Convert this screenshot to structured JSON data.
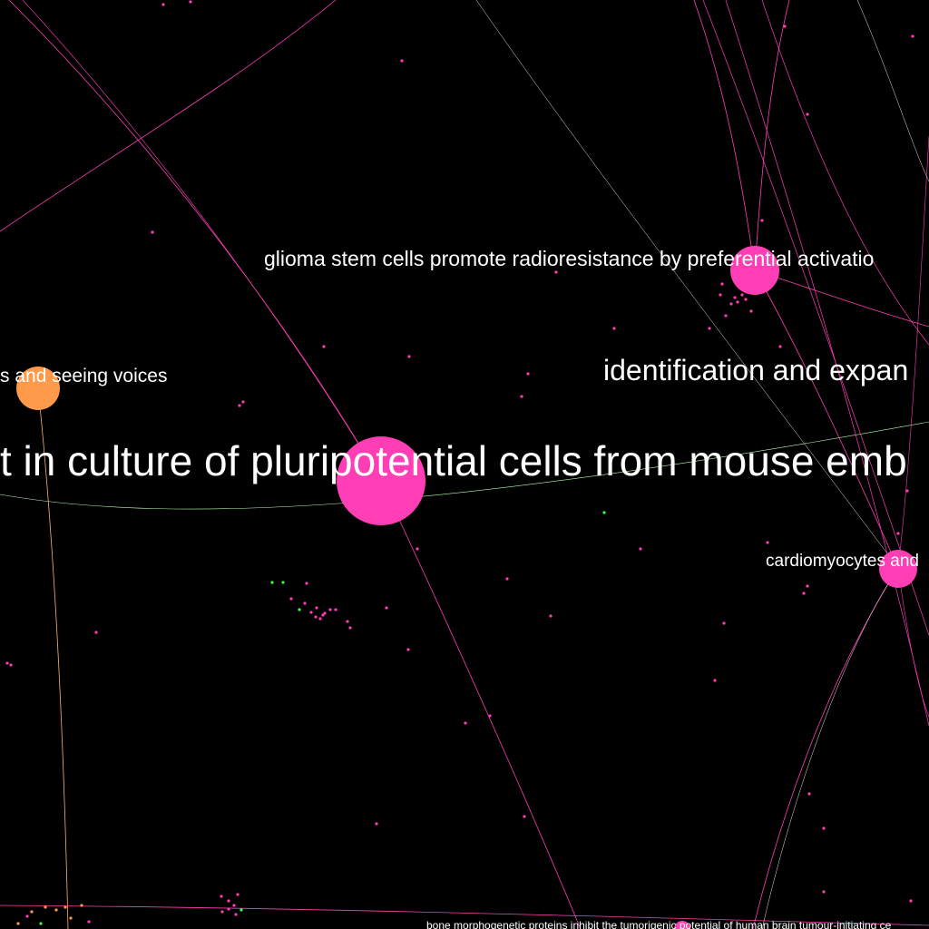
{
  "colors": {
    "background": "#000000",
    "pink": "#ff3eb5",
    "orange": "#ff9a4a",
    "green": "#3cff3c",
    "edge_pink": "#ff3eb5",
    "edge_green": "#b8ffb0",
    "edge_orange": "#ffb070",
    "edge_white": "#f0e0f0"
  },
  "labels": {
    "center": "t in culture of pluripotential cells from mouse emb",
    "glioma": "glioma stem cells promote radioresistance by preferential activatio",
    "identification": "identification and expan",
    "voices": "s and seeing voices",
    "cardio": "cardiomyocytes and",
    "bone": "bone morphogenetic proteins inhibit the tumorigenic potential of human brain tumour-initiating ce"
  }
}
